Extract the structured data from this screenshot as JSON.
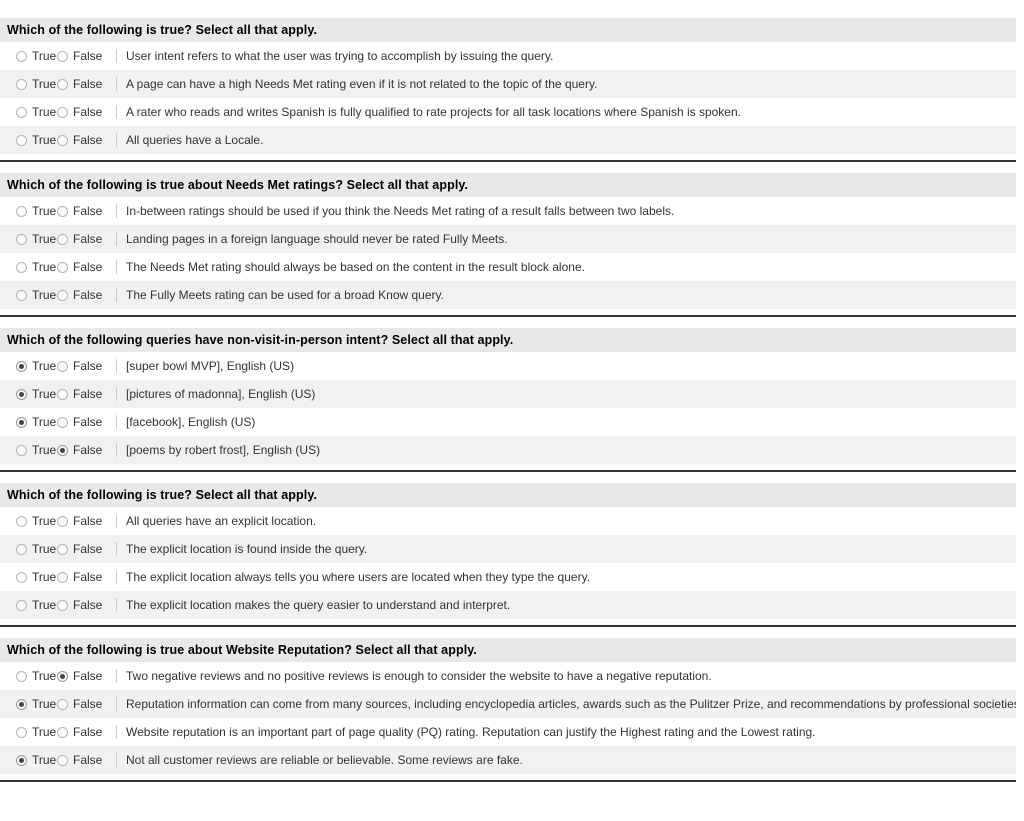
{
  "labels": {
    "true": "True",
    "false": "False"
  },
  "blocks": [
    {
      "header": "Which of the following is true? Select all that apply.",
      "rows": [
        {
          "statement": "User intent refers to what the user was trying to accomplish by issuing the query.",
          "selected": "none"
        },
        {
          "statement": "A page can have a high Needs Met rating even if it is not related to the topic of the query.",
          "selected": "none"
        },
        {
          "statement": "A rater who reads and writes Spanish is fully qualified to rate projects for all task locations where Spanish is spoken.",
          "selected": "none"
        },
        {
          "statement": "All queries have a Locale.",
          "selected": "none"
        }
      ]
    },
    {
      "header": "Which of the following is true about Needs Met ratings? Select all that apply.",
      "rows": [
        {
          "statement": "In-between ratings should be used if you think the Needs Met rating of a result falls between two labels.",
          "selected": "none"
        },
        {
          "statement": "Landing pages in a foreign language should never be rated Fully Meets.",
          "selected": "none"
        },
        {
          "statement": "The Needs Met rating should always be based on the content in the result block alone.",
          "selected": "none"
        },
        {
          "statement": "The Fully Meets rating can be used for a broad Know query.",
          "selected": "none"
        }
      ]
    },
    {
      "header": "Which of the following queries have non-visit-in-person intent? Select all that apply.",
      "rows": [
        {
          "statement": "[super bowl MVP], English (US)",
          "selected": "true"
        },
        {
          "statement": "[pictures of madonna], English (US)",
          "selected": "true"
        },
        {
          "statement": "[facebook], English (US)",
          "selected": "true"
        },
        {
          "statement": "[poems by robert frost], English (US)",
          "selected": "false"
        }
      ]
    },
    {
      "header": "Which of the following is true? Select all that apply.",
      "rows": [
        {
          "statement": "All queries have an explicit location.",
          "selected": "none"
        },
        {
          "statement": "The explicit location is found inside the query.",
          "selected": "none"
        },
        {
          "statement": "The explicit location always tells you where users are located when they type the query.",
          "selected": "none"
        },
        {
          "statement": "The explicit location makes the query easier to understand and interpret.",
          "selected": "none"
        }
      ]
    },
    {
      "header": "Which of the following is true about Website Reputation? Select all that apply.",
      "rows": [
        {
          "statement": "Two negative reviews and no positive reviews is enough to consider the website to have a negative reputation.",
          "selected": "false"
        },
        {
          "statement": "Reputation information can come from many sources, including encyclopedia articles, awards such as the Pulitzer Prize, and recommendations by professional societies.",
          "selected": "true"
        },
        {
          "statement": "Website reputation is an important part of page quality (PQ) rating. Reputation can justify the Highest rating and the Lowest rating.",
          "selected": "none"
        },
        {
          "statement": "Not all customer reviews are reliable or believable. Some reviews are fake.",
          "selected": "true"
        }
      ]
    }
  ]
}
